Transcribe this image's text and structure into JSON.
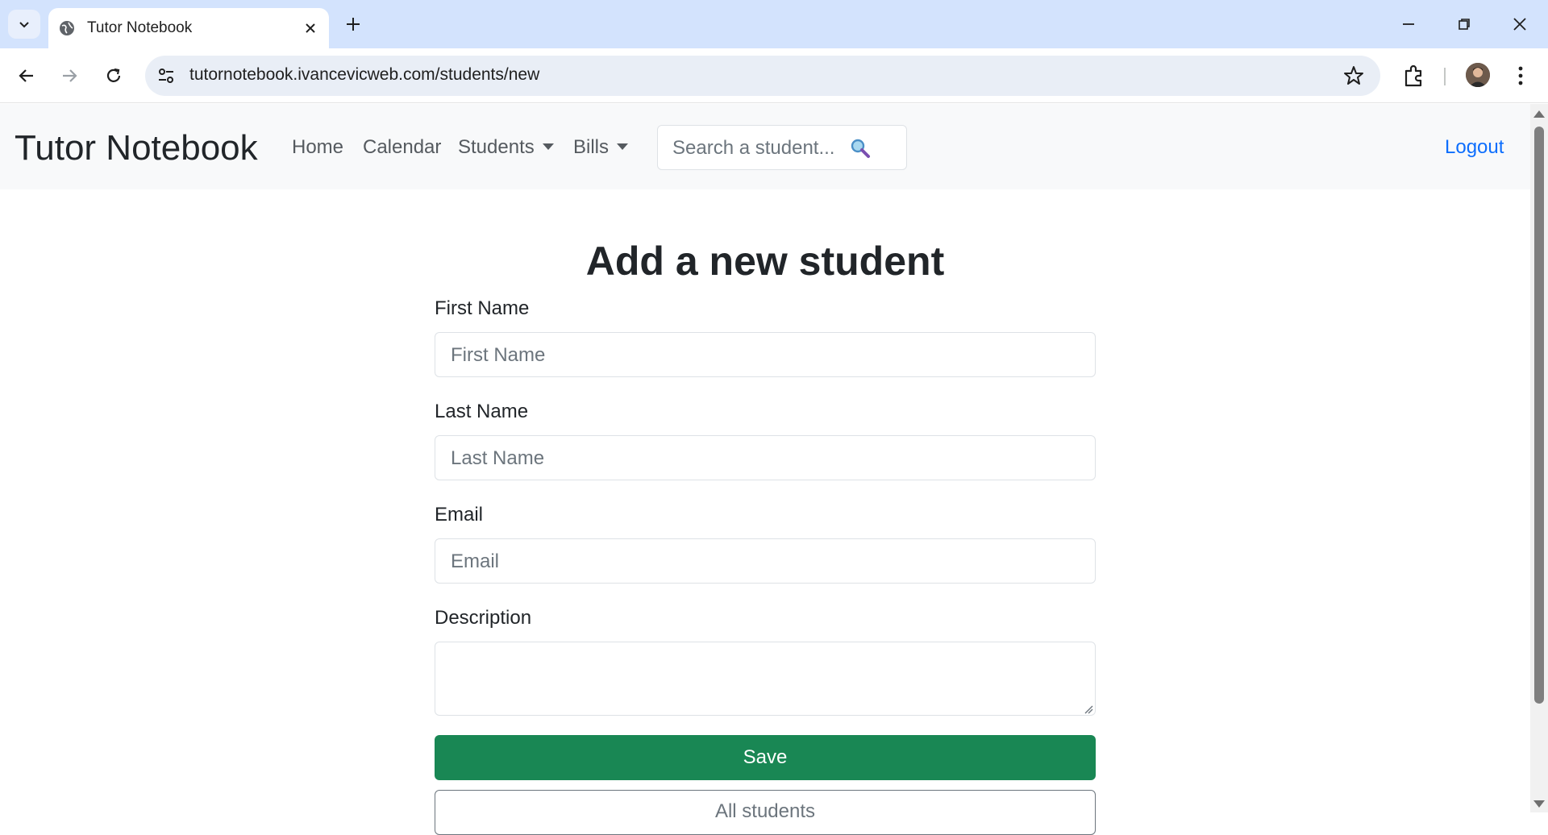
{
  "browser": {
    "tab_title": "Tutor Notebook",
    "url": "tutornotebook.ivancevicweb.com/students/new"
  },
  "navbar": {
    "brand": "Tutor Notebook",
    "links": [
      "Home",
      "Calendar",
      "Students",
      "Bills"
    ],
    "search_placeholder": "Search a student...",
    "logout": "Logout"
  },
  "form": {
    "heading": "Add a new student",
    "first_name_label": "First Name",
    "first_name_placeholder": "First Name",
    "last_name_label": "Last Name",
    "last_name_placeholder": "Last Name",
    "email_label": "Email",
    "email_placeholder": "Email",
    "description_label": "Description",
    "save_button": "Save",
    "all_students_button": "All students"
  },
  "colors": {
    "tabbar_bg": "#d3e3fd",
    "navbar_bg": "#f8f9fa",
    "save_green": "#198754",
    "logout_blue": "#0d6efd"
  },
  "icons": [
    "tab-search-icon",
    "globe-icon",
    "close-icon",
    "plus-icon",
    "minimize-icon",
    "restore-icon",
    "window-close-icon",
    "back-icon",
    "forward-icon",
    "reload-icon",
    "site-settings-icon",
    "star-icon",
    "extensions-icon",
    "avatar",
    "kebab-menu-icon",
    "magnifier-icon"
  ]
}
